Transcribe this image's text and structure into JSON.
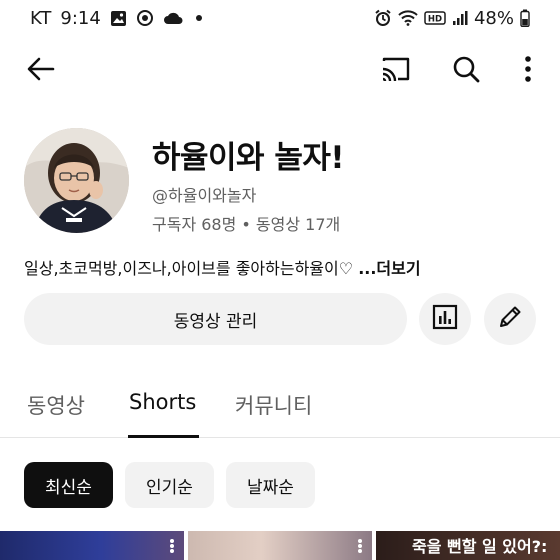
{
  "status_bar": {
    "carrier": "KT",
    "time": "9:14",
    "battery": "48%",
    "icons": [
      "image-icon",
      "sync-icon",
      "cloud-icon",
      "notification-dot-icon",
      "alarm-icon",
      "wifi-icon",
      "hd-icon",
      "signal-icon",
      "battery-icon"
    ]
  },
  "app_bar": {
    "icons": [
      "back-arrow-icon",
      "cast-icon",
      "search-icon",
      "more-vert-icon"
    ]
  },
  "channel": {
    "name": "하율이와 놀자!",
    "handle": "@하율이와놀자",
    "stats": "구독자 68명 • 동영상 17개",
    "description": "일상,초코먹방,이즈나,아이브를 좋아하는하율이♡ ",
    "more_label": "...더보기"
  },
  "actions": {
    "manage_label": "동영상 관리",
    "icons": [
      "analytics-icon",
      "edit-pencil-icon"
    ]
  },
  "tabs": [
    {
      "label": "동영상",
      "active": false
    },
    {
      "label": "Shorts",
      "active": true
    },
    {
      "label": "커뮤니티",
      "active": false
    }
  ],
  "chips": [
    {
      "label": "최신순",
      "active": true
    },
    {
      "label": "인기순",
      "active": false
    },
    {
      "label": "날짜순",
      "active": false
    }
  ],
  "thumbnails": [
    {
      "title": ""
    },
    {
      "title": ""
    },
    {
      "title": "죽을 뻔할 일 있어?:"
    }
  ],
  "colors": {
    "text_primary": "#0f0f0f",
    "text_secondary": "#606060",
    "chip_bg": "#f2f2f2",
    "active_chip_bg": "#0f0f0f"
  }
}
